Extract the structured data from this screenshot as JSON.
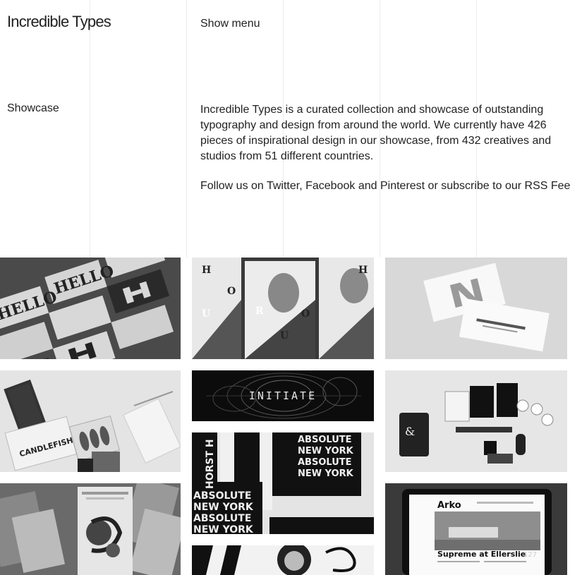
{
  "header": {
    "site_title": "Incredible Types",
    "menu_label": "Show menu"
  },
  "section": {
    "label": "Showcase"
  },
  "intro": {
    "text": "Incredible Types is a curated collection and showcase of outstanding typography and design from around the world. We currently have 426 pieces of inspirational design in our showcase, from 432 creatives and studios from 51 different countries."
  },
  "follow": {
    "prefix": "Follow us on ",
    "twitter": "Twitter",
    "sep1": ", ",
    "facebook": "Facebook",
    "sep2": " and ",
    "pinterest": "Pinterest",
    "middle": " or subscribe to our ",
    "rss": "RSS Feed"
  },
  "showcase": {
    "hello_cards": {
      "text1": "HELLO",
      "text2": "HELLO"
    },
    "uomo_magazine": {
      "letters": [
        "H",
        "O",
        "U",
        "R",
        "O",
        "U",
        "H"
      ]
    },
    "initiate": {
      "text": "INITIATE"
    },
    "absolute_new_york": {
      "lines": [
        "ABSOLUTE",
        "NEW YORK",
        "ABSOLUTE",
        "NEW YORK",
        "ABSOLUTE"
      ],
      "vertical": "HORST H"
    },
    "candlefish": {
      "text": "CANDLEFISH"
    },
    "arko_site": {
      "brand": "Arko",
      "headline": "Supreme at Ellerslie",
      "number": "127"
    }
  }
}
